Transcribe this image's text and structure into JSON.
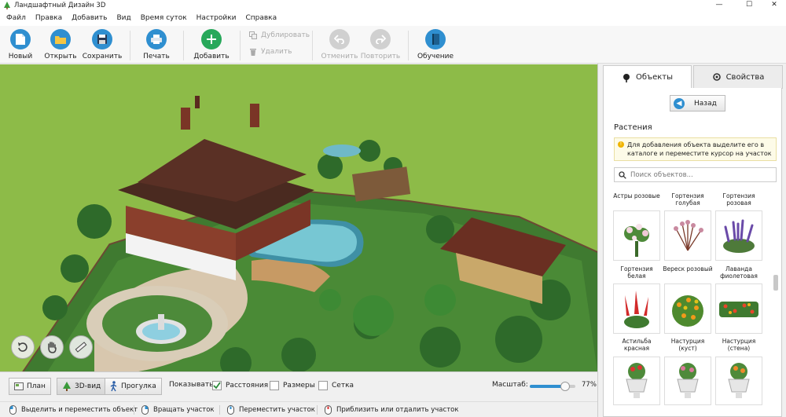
{
  "window": {
    "title": "Ландшафтный Дизайн 3D",
    "minimize_glyph": "—",
    "maximize_glyph": "☐",
    "close_glyph": "✕"
  },
  "menu": [
    "Файл",
    "Правка",
    "Добавить",
    "Вид",
    "Время суток",
    "Настройки",
    "Справка"
  ],
  "toolbar": {
    "new_label": "Новый",
    "open_label": "Открыть",
    "save_label": "Сохранить",
    "print_label": "Печать",
    "add_label": "Добавить",
    "duplicate_label": "Дублировать",
    "delete_label": "Удалить",
    "undo_label": "Отменить",
    "redo_label": "Повторить",
    "learn_label": "Обучение"
  },
  "panel": {
    "tabs": {
      "objects": "Объекты",
      "properties": "Свойства"
    },
    "back_label": "Назад",
    "back_icon": "arrow-left-icon",
    "section_title": "Растения",
    "hint": "Для добавления объекта выделите его в каталоге и переместите курсор на участок",
    "hint_icon": "!",
    "search_placeholder": "Поиск объектов...",
    "items": [
      {
        "label": "Астры розовые",
        "icon": "aster-plant"
      },
      {
        "label": "Гортензия голубая",
        "icon": "hydrangea-plant"
      },
      {
        "label": "Гортензия розовая",
        "icon": "hydrangea-plant"
      },
      {
        "label": "Гортензия белая",
        "icon": "white-hydrangea-plant"
      },
      {
        "label": "Вереск розовый",
        "icon": "heather-plant"
      },
      {
        "label": "Лаванда фиолетовая",
        "icon": "lavender-plant"
      },
      {
        "label": "Астильба красная",
        "icon": "astilbe-plant"
      },
      {
        "label": "Настурция (куст)",
        "icon": "nasturtium-bush"
      },
      {
        "label": "Настурция (стена)",
        "icon": "nasturtium-wall"
      },
      {
        "label": "",
        "icon": "potted-plant-red"
      },
      {
        "label": "",
        "icon": "potted-plant-pink"
      },
      {
        "label": "",
        "icon": "potted-plant-orange"
      }
    ]
  },
  "viewmodes": {
    "plan": "План",
    "view3d": "3D-вид",
    "walk": "Прогулка",
    "active": "3D-вид"
  },
  "show": {
    "label": "Показывать:",
    "distances": {
      "label": "Расстояния",
      "checked": true
    },
    "sizes": {
      "label": "Размеры",
      "checked": false
    },
    "grid": {
      "label": "Сетка",
      "checked": false
    }
  },
  "zoom": {
    "label": "Масштаб:",
    "value_text": "77%",
    "value": 0.77
  },
  "status": {
    "select_move": "Выделить и переместить объект",
    "rotate": "Вращать участок",
    "pan": "Переместить участок",
    "zoom": "Приблизить или отдалить участок"
  },
  "colors": {
    "accent": "#2f8fd0",
    "grass": "#8dbb48",
    "check": "#2a8a3a"
  }
}
